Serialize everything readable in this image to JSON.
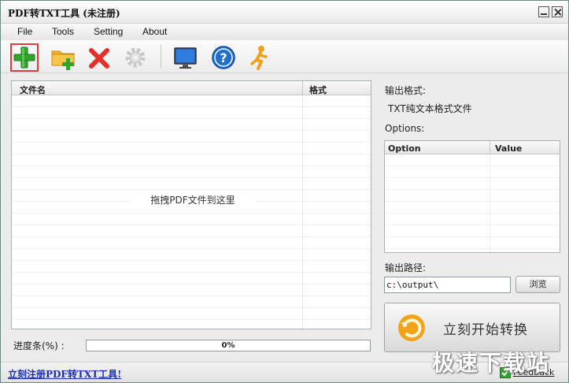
{
  "window": {
    "title": "PDF转TXT工具 (未注册)"
  },
  "menu": {
    "items": [
      "File",
      "Tools",
      "Setting",
      "About"
    ]
  },
  "toolbar": {
    "icons": [
      "add-file-icon",
      "add-folder-icon",
      "remove-icon",
      "settings-gear-icon",
      "monitor-icon",
      "help-icon",
      "runner-icon"
    ]
  },
  "filelist": {
    "col_name": "文件名",
    "col_format": "格式",
    "drop_hint": "拖拽PDF文件到这里"
  },
  "right": {
    "output_format_label": "输出格式:",
    "output_format_value": "TXT纯文本格式文件",
    "options_label": "Options:",
    "option_col": "Option",
    "value_col": "Value",
    "output_path_label": "输出路径:",
    "output_path_value": "c:\\output\\",
    "browse_label": "浏览",
    "start_label": "立刻开始转换"
  },
  "progress": {
    "label": "进度条(%) :",
    "value": 0,
    "text": "0%"
  },
  "status": {
    "register_link": "立刻注册PDF转TXT工具!",
    "feedback": "Feedback"
  },
  "watermark": "极速下载站",
  "colors": {
    "accent_green": "#2fa52b",
    "remove_red": "#e0312a",
    "help_blue": "#1f6fd1",
    "link_blue": "#1a2fb0"
  }
}
